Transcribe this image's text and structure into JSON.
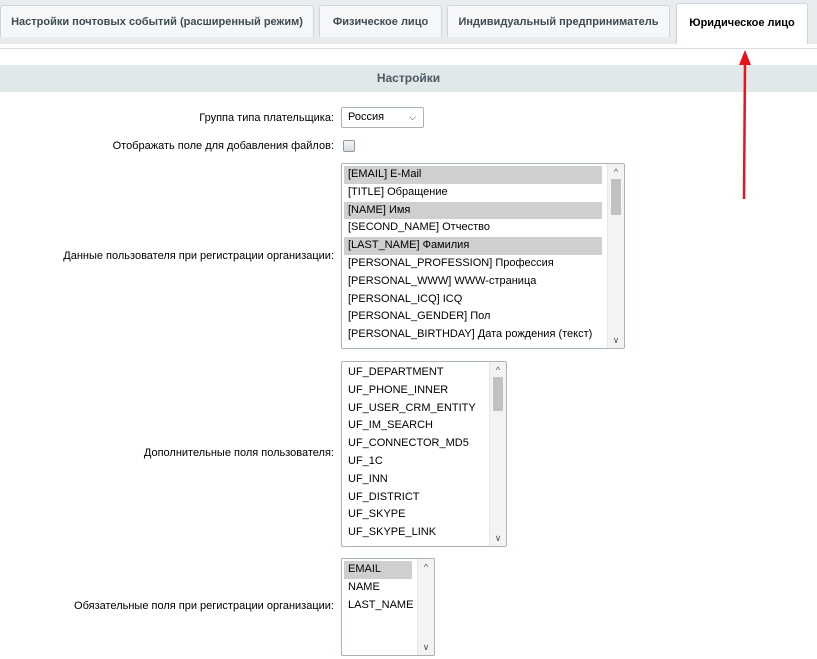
{
  "tabs": [
    {
      "label": "Настройки почтовых событий (расширенный режим)",
      "active": false
    },
    {
      "label": "Физическое лицо",
      "active": false
    },
    {
      "label": "Индивидуальный предприниматель",
      "active": false
    },
    {
      "label": "Юридическое лицо",
      "active": true
    }
  ],
  "section": {
    "title": "Настройки"
  },
  "fields": {
    "payer_group": {
      "label": "Группа типа плательщика:",
      "value": "Россия",
      "arrow_icon": "chevron-down-icon"
    },
    "show_file_field": {
      "label": "Отображать поле для добавления файлов:",
      "checked": false
    },
    "user_data": {
      "label": "Данные пользователя при регистрации организации:",
      "items": [
        {
          "text": "[EMAIL] E-Mail",
          "selected": true
        },
        {
          "text": "[TITLE] Обращение",
          "selected": false
        },
        {
          "text": "[NAME] Имя",
          "selected": true
        },
        {
          "text": "[SECOND_NAME] Отчество",
          "selected": false
        },
        {
          "text": "[LAST_NAME] Фамилия",
          "selected": true
        },
        {
          "text": "[PERSONAL_PROFESSION] Профессия",
          "selected": false
        },
        {
          "text": "[PERSONAL_WWW] WWW-страница",
          "selected": false
        },
        {
          "text": "[PERSONAL_ICQ] ICQ",
          "selected": false
        },
        {
          "text": "[PERSONAL_GENDER] Пол",
          "selected": false
        },
        {
          "text": "[PERSONAL_BIRTHDAY] Дата рождения (текст)",
          "selected": false
        }
      ]
    },
    "extra_fields": {
      "label": "Дополнительные поля пользователя:",
      "items": [
        {
          "text": "UF_DEPARTMENT",
          "selected": false
        },
        {
          "text": "UF_PHONE_INNER",
          "selected": false
        },
        {
          "text": "UF_USER_CRM_ENTITY",
          "selected": false
        },
        {
          "text": "UF_IM_SEARCH",
          "selected": false
        },
        {
          "text": "UF_CONNECTOR_MD5",
          "selected": false
        },
        {
          "text": "UF_1C",
          "selected": false
        },
        {
          "text": "UF_INN",
          "selected": false
        },
        {
          "text": "UF_DISTRICT",
          "selected": false
        },
        {
          "text": "UF_SKYPE",
          "selected": false
        },
        {
          "text": "UF_SKYPE_LINK",
          "selected": false
        }
      ]
    },
    "required_fields": {
      "label": "Обязательные поля при регистрации организации:",
      "items": [
        {
          "text": "EMAIL",
          "selected": true
        },
        {
          "text": "NAME",
          "selected": false
        },
        {
          "text": "LAST_NAME",
          "selected": false
        }
      ]
    }
  },
  "colors": {
    "annotation_arrow": "#e8141b",
    "selected_row": "#cfcfcf",
    "section_header_bg": "#e0e8ea"
  }
}
